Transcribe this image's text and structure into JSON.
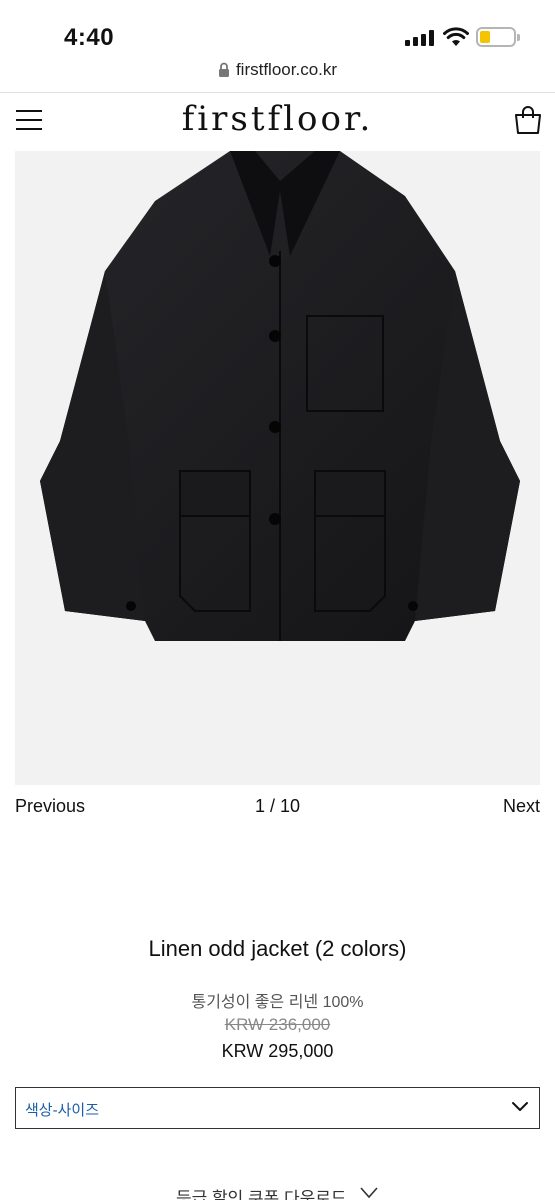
{
  "status_bar": {
    "time": "4:40"
  },
  "browser": {
    "url": "firstfloor.co.kr"
  },
  "header": {
    "logo": "firstfloor."
  },
  "gallery": {
    "prev_label": "Previous",
    "counter": "1 / 10",
    "next_label": "Next"
  },
  "product": {
    "title": "Linen odd jacket (2 colors)",
    "description": "통기성이 좋은 리넨 100%",
    "original_price": "KRW 236,000",
    "price": "KRW 295,000"
  },
  "options": {
    "select_label": "색상-사이즈"
  },
  "coupon": {
    "label": "등급 할인 쿠폰 다운로드"
  },
  "colors": {
    "select_text": "#1a5ea8",
    "battery": "#f5c400",
    "jacket": "#1c1c1e"
  }
}
